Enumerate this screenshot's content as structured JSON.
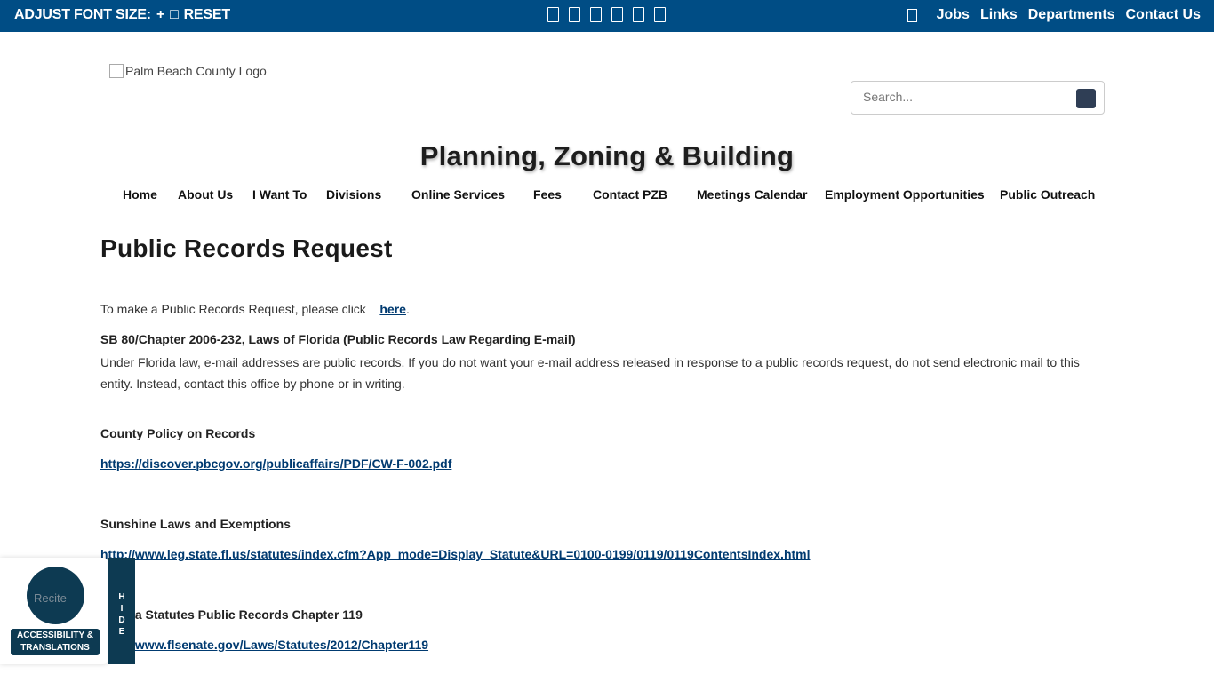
{
  "topbar": {
    "font_label": "ADJUST FONT SIZE:",
    "plus": "+",
    "minus_icon": "□",
    "reset": "RESET",
    "social_icons": [
      "facebook-icon",
      "twitter-icon",
      "youtube-icon",
      "instagram-icon",
      "linkedin-icon",
      "nextdoor-icon"
    ],
    "links": [
      "Jobs",
      "Links",
      "Departments",
      "Contact Us"
    ]
  },
  "header": {
    "logo_alt": "Palm Beach County Logo",
    "search_placeholder": "Search...",
    "site_title": "Planning, Zoning & Building"
  },
  "nav": [
    "Home",
    "About Us",
    "I Want To",
    "Divisions",
    "Online Services",
    "Fees",
    "Contact PZB",
    "Meetings Calendar",
    "Employment Opportunities",
    "Public Outreach"
  ],
  "main": {
    "page_title": "Public Records Request",
    "intro_text": "To make a Public Records Request, please click",
    "intro_link": "here",
    "intro_end": ".",
    "sb80_heading": "SB 80/Chapter 2006-232, Laws of Florida (Public Records Law Regarding E-mail)",
    "sb80_body": "Under Florida law, e-mail addresses are public records. If you do not want your e-mail address released in response to a public records request, do not send electronic mail to this entity. Instead, contact this office by phone or in writing.",
    "county_policy_heading": "County Policy on Records",
    "county_policy_link": "https://discover.pbcgov.org/publicaffairs/PDF/CW-F-002.pdf",
    "sunshine_heading": "Sunshine Laws and Exemptions",
    "sunshine_link": "http://www.leg.state.fl.us/statutes/index.cfm?App_mode=Display_Statute&URL=0100-0199/0119/0119ContentsIndex.html",
    "statutes_heading": "Florida Statutes Public Records Chapter 119",
    "statutes_link": "http://www.flsenate.gov/Laws/Statutes/2012/Chapter119"
  },
  "a11y": {
    "img_alt": "Recite",
    "label_line1": "ACCESSIBILITY &",
    "label_line2": "TRANSLATIONS",
    "hide": [
      "H",
      "I",
      "D",
      "E"
    ]
  }
}
